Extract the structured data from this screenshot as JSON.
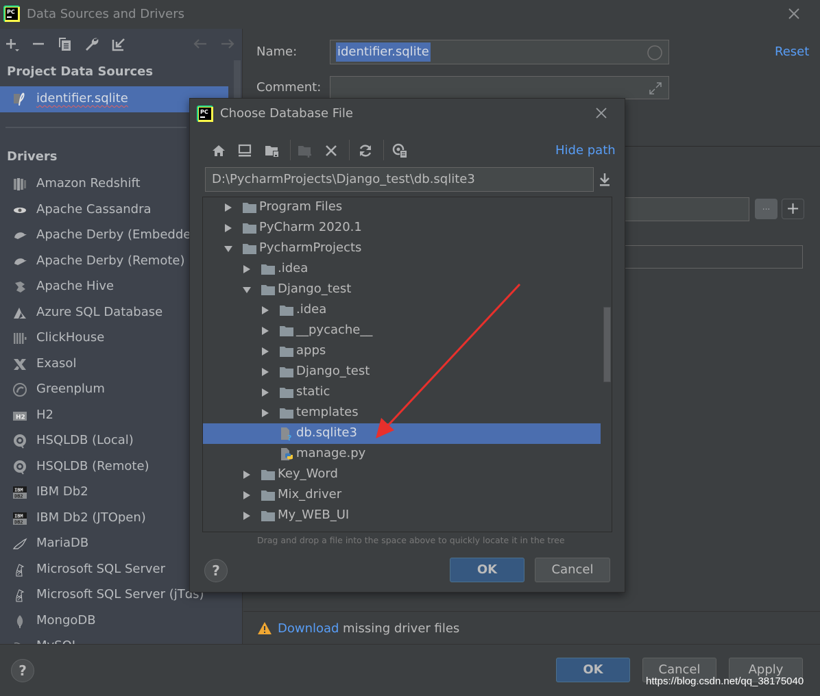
{
  "window": {
    "title": "Data Sources and Drivers",
    "close_icon": "close-icon"
  },
  "left_toolbar": {
    "icons": [
      "add-icon",
      "remove-icon",
      "duplicate-icon",
      "wrench-icon",
      "import-icon",
      "back-arrow-icon",
      "forward-arrow-icon"
    ]
  },
  "project_sources": {
    "header": "Project Data Sources",
    "items": [
      {
        "label": "identifier.sqlite",
        "icon": "sqlite-feather-icon",
        "selected": true
      }
    ]
  },
  "drivers": {
    "header": "Drivers",
    "items": [
      {
        "label": "Amazon Redshift",
        "icon": "redshift-icon"
      },
      {
        "label": "Apache Cassandra",
        "icon": "cassandra-eye-icon"
      },
      {
        "label": "Apache Derby (Embedded)",
        "icon": "derby-hat-icon"
      },
      {
        "label": "Apache Derby (Remote)",
        "icon": "derby-hat-icon"
      },
      {
        "label": "Apache Hive",
        "icon": "hive-bee-icon"
      },
      {
        "label": "Azure SQL Database",
        "icon": "azure-icon"
      },
      {
        "label": "ClickHouse",
        "icon": "clickhouse-bars-icon"
      },
      {
        "label": "Exasol",
        "icon": "exasol-x-icon"
      },
      {
        "label": "Greenplum",
        "icon": "greenplum-circle-icon"
      },
      {
        "label": "H2",
        "icon": "h2-badge-icon"
      },
      {
        "label": "HSQLDB (Local)",
        "icon": "hsqldb-icon"
      },
      {
        "label": "HSQLDB (Remote)",
        "icon": "hsqldb-icon"
      },
      {
        "label": "IBM Db2",
        "icon": "ibm-db2-icon"
      },
      {
        "label": "IBM Db2 (JTOpen)",
        "icon": "ibm-db2-icon"
      },
      {
        "label": "MariaDB",
        "icon": "mariadb-seal-icon"
      },
      {
        "label": "Microsoft SQL Server",
        "icon": "mssql-icon"
      },
      {
        "label": "Microsoft SQL Server (jTds)",
        "icon": "mssql-icon"
      },
      {
        "label": "MongoDB",
        "icon": "mongodb-leaf-icon"
      },
      {
        "label": "MySQL",
        "icon": "mysql-dolphin-icon"
      }
    ]
  },
  "details": {
    "name_label": "Name:",
    "name_value": "identifier.sqlite",
    "comment_label": "Comment:",
    "comment_value": "",
    "reset_label": "Reset",
    "browse_button": "...",
    "add_button": "+"
  },
  "warning": {
    "link": "Download",
    "text": "missing driver files"
  },
  "footer": {
    "ok": "OK",
    "cancel": "Cancel",
    "apply": "Apply",
    "help": "?"
  },
  "chooser": {
    "title": "Choose Database File",
    "toolbar_icons": [
      "home-icon",
      "desktop-icon",
      "project-folder-icon",
      "new-folder-icon",
      "delete-icon",
      "refresh-icon",
      "show-hidden-icon"
    ],
    "hide_path": "Hide path",
    "path": "D:\\PycharmProjects\\Django_test\\db.sqlite3",
    "tree": [
      {
        "name": "Program Files",
        "depth": 0,
        "type": "folder",
        "state": "collapsed"
      },
      {
        "name": "PyCharm 2020.1",
        "depth": 0,
        "type": "folder",
        "state": "collapsed"
      },
      {
        "name": "PycharmProjects",
        "depth": 0,
        "type": "folder",
        "state": "expanded"
      },
      {
        "name": ".idea",
        "depth": 1,
        "type": "folder",
        "state": "collapsed"
      },
      {
        "name": "Django_test",
        "depth": 1,
        "type": "folder",
        "state": "expanded"
      },
      {
        "name": ".idea",
        "depth": 2,
        "type": "folder",
        "state": "collapsed"
      },
      {
        "name": "__pycache__",
        "depth": 2,
        "type": "folder",
        "state": "collapsed"
      },
      {
        "name": "apps",
        "depth": 2,
        "type": "folder",
        "state": "collapsed"
      },
      {
        "name": "Django_test",
        "depth": 2,
        "type": "folder",
        "state": "collapsed"
      },
      {
        "name": "static",
        "depth": 2,
        "type": "folder",
        "state": "collapsed"
      },
      {
        "name": "templates",
        "depth": 2,
        "type": "folder",
        "state": "collapsed"
      },
      {
        "name": "db.sqlite3",
        "depth": 2,
        "type": "unknown-file",
        "state": "leaf",
        "selected": true
      },
      {
        "name": "manage.py",
        "depth": 2,
        "type": "python-file",
        "state": "leaf"
      },
      {
        "name": "Key_Word",
        "depth": 1,
        "type": "folder",
        "state": "collapsed"
      },
      {
        "name": "Mix_driver",
        "depth": 1,
        "type": "folder",
        "state": "collapsed"
      },
      {
        "name": "My_WEB_UI",
        "depth": 1,
        "type": "folder",
        "state": "collapsed"
      }
    ],
    "hint": "Drag and drop a file into the space above to quickly locate it in the tree",
    "ok": "OK",
    "cancel": "Cancel",
    "help": "?"
  },
  "watermark": "https://blog.csdn.net/qq_38175040",
  "colors": {
    "accent": "#4b6eaf",
    "link": "#589df6",
    "primary_button": "#365880",
    "warning": "#f0a732",
    "annotation_arrow": "#e8302c"
  }
}
